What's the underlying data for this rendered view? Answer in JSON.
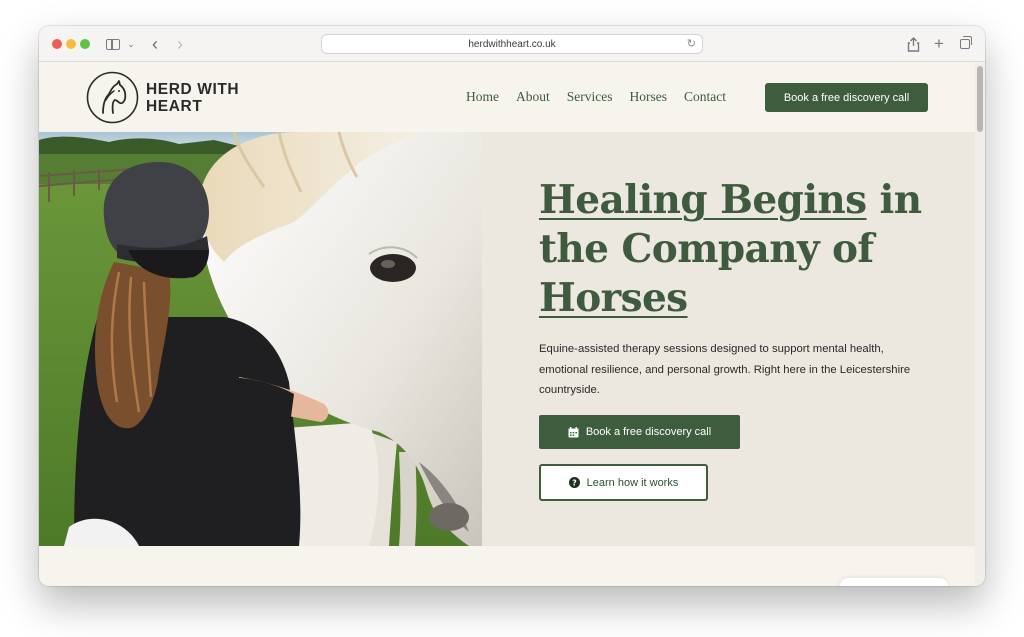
{
  "browser": {
    "url": "herdwithheart.co.uk"
  },
  "site": {
    "logo_line1": "HERD WITH",
    "logo_line2": "HEART",
    "nav": [
      "Home",
      "About",
      "Services",
      "Horses",
      "Contact"
    ],
    "header_cta": "Book a free discovery call"
  },
  "hero": {
    "title_part1": "Healing Begins",
    "title_part2": " in the Company of ",
    "title_part3": "Horses",
    "description": "Equine-assisted therapy sessions designed to support mental health, emotional resilience, and personal growth. Right here in the Leicestershire countryside.",
    "primary_button": "Book a free discovery call",
    "secondary_button": "Learn how it works",
    "primary_icon": "calendar-icon",
    "secondary_icon": "question-circle-icon"
  },
  "colors": {
    "brand_green": "#3e5d3f",
    "background": "#f7f3ed",
    "hero_background": "#ece7df"
  }
}
